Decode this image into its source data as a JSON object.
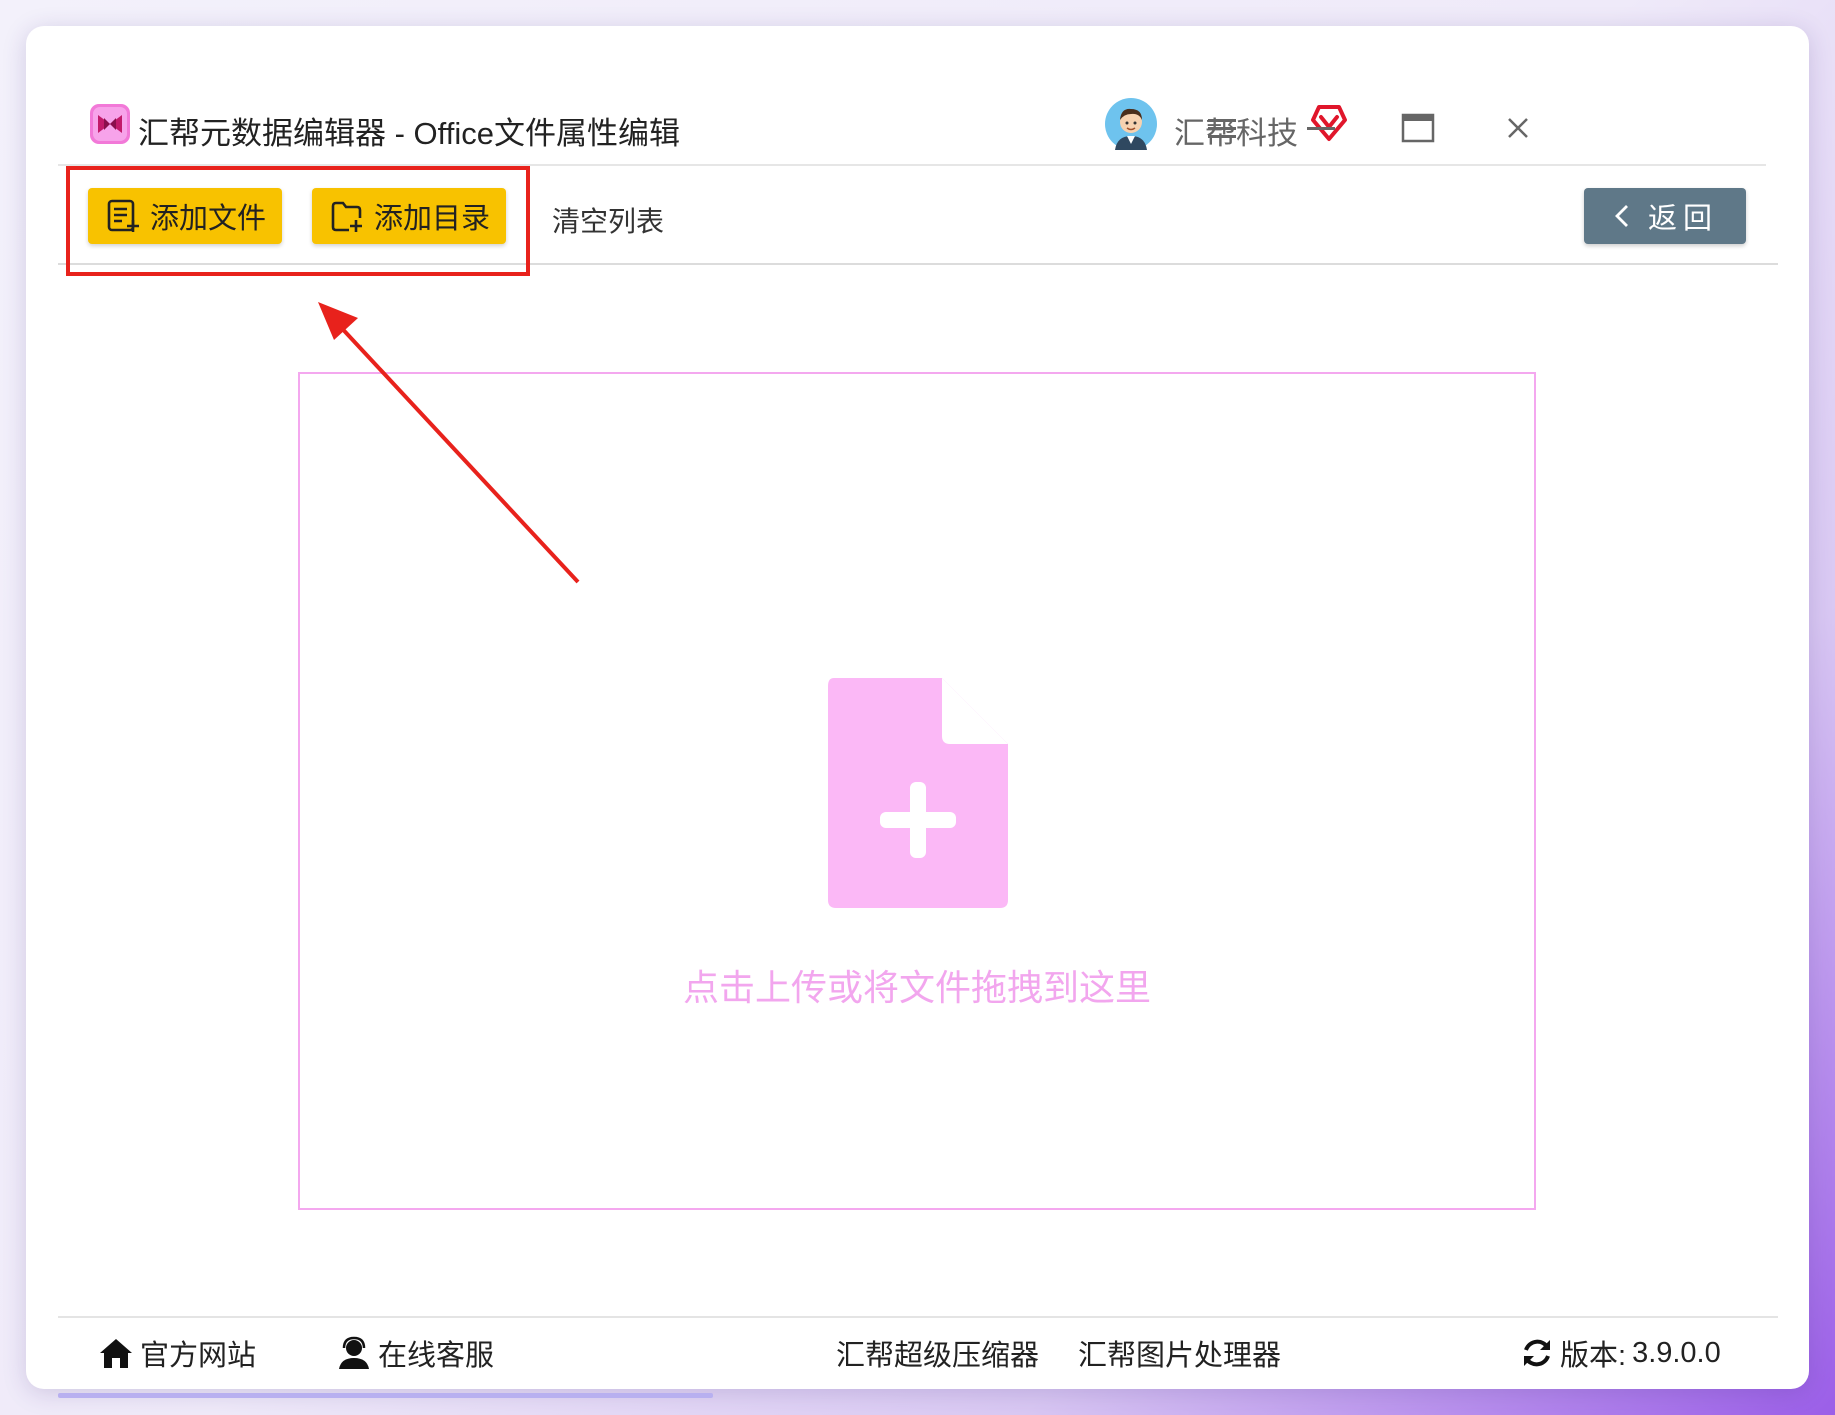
{
  "window": {
    "title": "汇帮元数据编辑器 - Office文件属性编辑",
    "user_name": "汇帮科技",
    "icons": {
      "logo": "app-logo",
      "avatar": "user-avatar",
      "vip": "vip-diamond-icon",
      "menu": "hamburger-menu-icon",
      "minimize": "minimize-icon",
      "maximize": "maximize-icon",
      "close": "close-icon"
    }
  },
  "toolbar": {
    "add_file_label": "添加文件",
    "add_folder_label": "添加目录",
    "clear_list_label": "清空列表",
    "back_label": "返回"
  },
  "drop_zone": {
    "hint": "点击上传或将文件拖拽到这里"
  },
  "statusbar": {
    "official_site": "官方网站",
    "online_support": "在线客服",
    "compressor_link": "汇帮超级压缩器",
    "image_processor_link": "汇帮图片处理器",
    "version_label": "版本:",
    "version_value": "3.9.0.0"
  },
  "colors": {
    "button_yellow": "#f8c200",
    "back_button": "#5f7888",
    "drop_accent": "#f4a8ef",
    "annotation_red": "#e8221c"
  }
}
